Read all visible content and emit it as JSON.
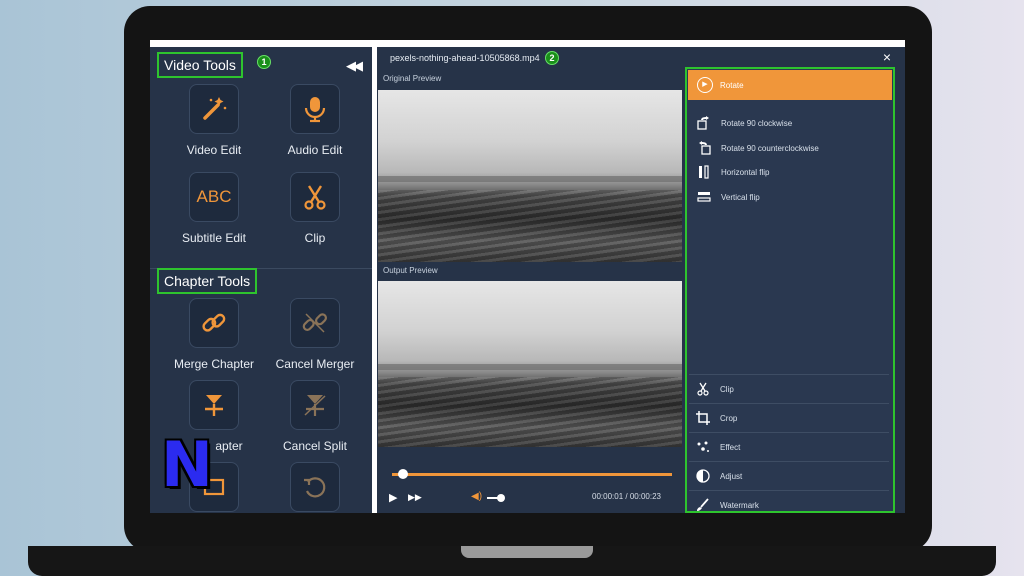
{
  "left_panel": {
    "video_tools": {
      "title": "Video Tools",
      "badge": "1",
      "items": [
        {
          "label": "Video Edit",
          "icon": "magic-wand-icon"
        },
        {
          "label": "Audio Edit",
          "icon": "microphone-icon"
        },
        {
          "label": "Subtitle Edit",
          "icon": "abc-text-icon",
          "icon_text": "ABC"
        },
        {
          "label": "Clip",
          "icon": "scissors-icon"
        }
      ]
    },
    "chapter_tools": {
      "title": "Chapter Tools",
      "items": [
        {
          "label": "Merge Chapter",
          "icon": "link-icon"
        },
        {
          "label": "Cancel Merger",
          "icon": "broken-link-icon"
        },
        {
          "label": "apter",
          "icon": "split-icon"
        },
        {
          "label": "Cancel Split",
          "icon": "cancel-split-icon"
        }
      ]
    }
  },
  "editor": {
    "file_name": "pexels-nothing-ahead-10505868.mp4",
    "badge": "2",
    "close_label": "×",
    "original_label": "Original Preview",
    "output_label": "Output Preview",
    "playback": {
      "current_time": "00:00:01",
      "separator": "/",
      "total_time": "00:00:23",
      "progress": 0.04,
      "volume": 0.6
    }
  },
  "effects_panel": {
    "active": {
      "label": "Rotate",
      "icon": "rotate-icon"
    },
    "rotate_options": [
      {
        "label": "Rotate 90 clockwise",
        "icon": "rotate-cw-icon"
      },
      {
        "label": "Rotate 90 counterclockwise",
        "icon": "rotate-ccw-icon"
      },
      {
        "label": "Horizontal flip",
        "icon": "horizontal-flip-icon"
      },
      {
        "label": "Vertical flip",
        "icon": "vertical-flip-icon"
      }
    ],
    "tools": [
      {
        "label": "Clip",
        "icon": "scissors-icon"
      },
      {
        "label": "Crop",
        "icon": "crop-icon"
      },
      {
        "label": "Effect",
        "icon": "sparkle-icon"
      },
      {
        "label": "Adjust",
        "icon": "adjust-icon"
      },
      {
        "label": "Watermark",
        "icon": "brush-icon"
      }
    ]
  },
  "colors": {
    "accent": "#f0963a",
    "highlight_border": "#2ec42e",
    "panel_bg": "#263348",
    "logo_blue": "#2b2bf0"
  }
}
